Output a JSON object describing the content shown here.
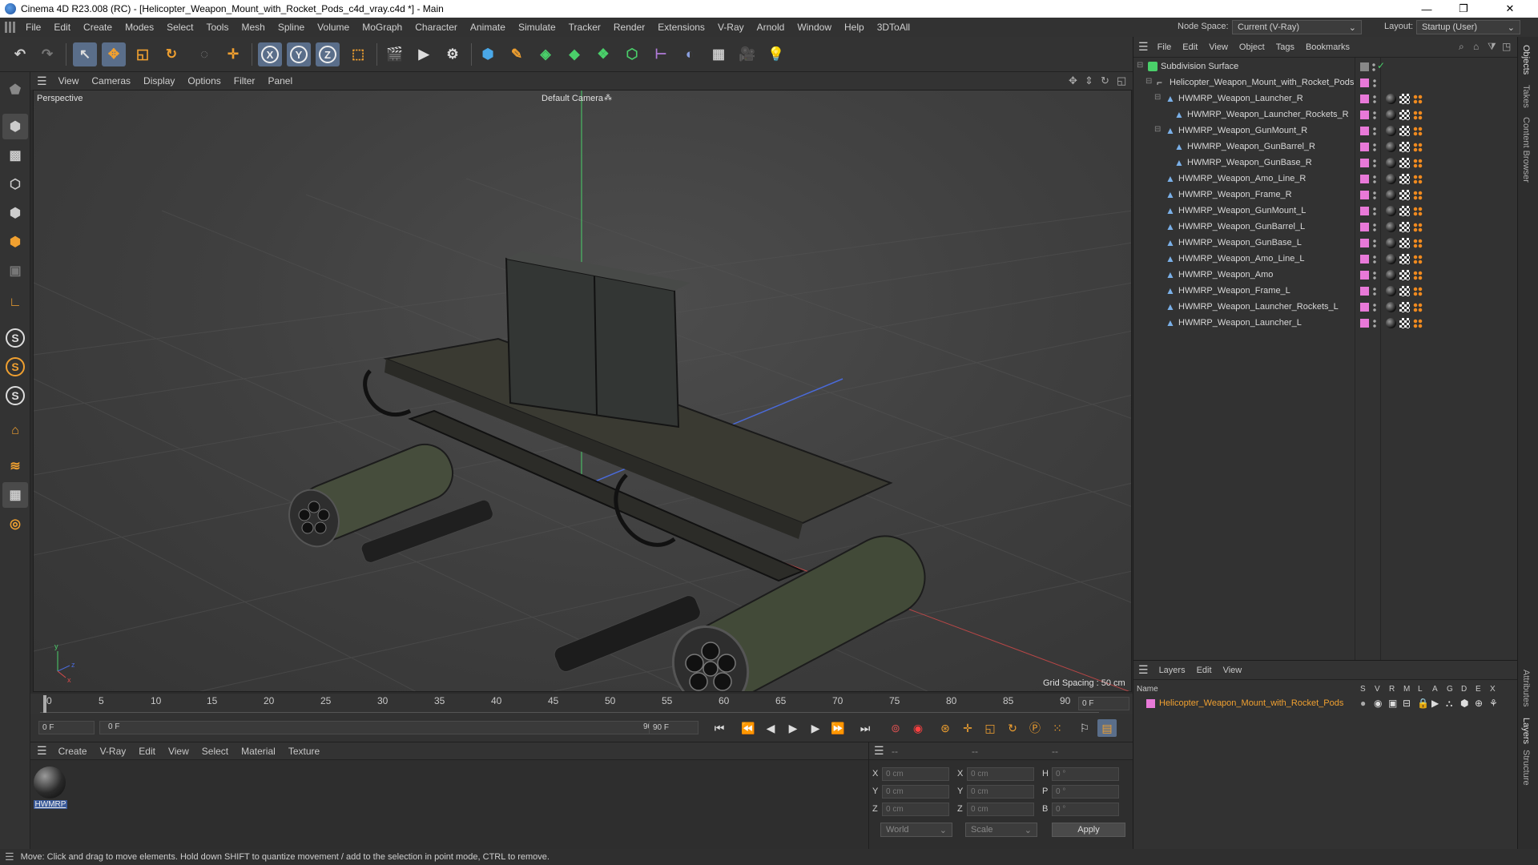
{
  "window": {
    "title": "Cinema 4D R23.008 (RC) - [Helicopter_Weapon_Mount_with_Rocket_Pods_c4d_vray.c4d *] - Main",
    "minimize": "—",
    "maximize": "❐",
    "close": "✕"
  },
  "menubar": {
    "items": [
      "File",
      "Edit",
      "Create",
      "Modes",
      "Select",
      "Tools",
      "Mesh",
      "Spline",
      "Volume",
      "MoGraph",
      "Character",
      "Animate",
      "Simulate",
      "Tracker",
      "Render",
      "Extensions",
      "V-Ray",
      "Arnold",
      "Window",
      "Help",
      "3DToAll"
    ],
    "node_space_label": "Node Space:",
    "node_space_value": "Current (V-Ray)",
    "layout_label": "Layout:",
    "layout_value": "Startup (User)"
  },
  "toolbar": {
    "x_label": "X",
    "y_label": "Y",
    "z_label": "Z"
  },
  "viewport": {
    "menu": [
      "View",
      "Cameras",
      "Display",
      "Options",
      "Filter",
      "Panel"
    ],
    "projection": "Perspective",
    "camera": "Default Camera",
    "grid_spacing": "Grid Spacing : 50 cm"
  },
  "timeline": {
    "ticks": [
      "0",
      "5",
      "10",
      "15",
      "20",
      "25",
      "30",
      "35",
      "40",
      "45",
      "50",
      "55",
      "60",
      "65",
      "70",
      "75",
      "80",
      "85",
      "90"
    ],
    "current_frame": "0 F",
    "start_field": "0 F",
    "range_start": "0 F",
    "range_end": "90 F",
    "end_field": "90 F"
  },
  "material_manager": {
    "menu": [
      "Create",
      "V-Ray",
      "Edit",
      "View",
      "Select",
      "Material",
      "Texture"
    ],
    "material_name": "HWMRP"
  },
  "coordinates": {
    "header_dashes": [
      "--",
      "--",
      "--"
    ],
    "rows": [
      {
        "a": "X",
        "av": "0 cm",
        "b": "X",
        "bv": "0 cm",
        "c": "H",
        "cv": "0 °"
      },
      {
        "a": "Y",
        "av": "0 cm",
        "b": "Y",
        "bv": "0 cm",
        "c": "P",
        "cv": "0 °"
      },
      {
        "a": "Z",
        "av": "0 cm",
        "b": "Z",
        "bv": "0 cm",
        "c": "B",
        "cv": "0 °"
      }
    ],
    "space": "World",
    "mode": "Scale",
    "apply": "Apply"
  },
  "object_manager": {
    "menu": [
      "File",
      "Edit",
      "View",
      "Object",
      "Tags",
      "Bookmarks"
    ],
    "objects": [
      {
        "name": "Subdivision Surface",
        "depth": 0,
        "type": "subdiv"
      },
      {
        "name": "Helicopter_Weapon_Mount_with_Rocket_Pods",
        "depth": 1,
        "type": "null"
      },
      {
        "name": "HWMRP_Weapon_Launcher_R",
        "depth": 2,
        "type": "mesh"
      },
      {
        "name": "HWMRP_Weapon_Launcher_Rockets_R",
        "depth": 3,
        "type": "mesh"
      },
      {
        "name": "HWMRP_Weapon_GunMount_R",
        "depth": 2,
        "type": "mesh"
      },
      {
        "name": "HWMRP_Weapon_GunBarrel_R",
        "depth": 3,
        "type": "mesh"
      },
      {
        "name": "HWMRP_Weapon_GunBase_R",
        "depth": 3,
        "type": "mesh"
      },
      {
        "name": "HWMRP_Weapon_Amo_Line_R",
        "depth": 2,
        "type": "mesh"
      },
      {
        "name": "HWMRP_Weapon_Frame_R",
        "depth": 2,
        "type": "mesh"
      },
      {
        "name": "HWMRP_Weapon_GunMount_L",
        "depth": 2,
        "type": "mesh"
      },
      {
        "name": "HWMRP_Weapon_GunBarrel_L",
        "depth": 2,
        "type": "mesh"
      },
      {
        "name": "HWMRP_Weapon_GunBase_L",
        "depth": 2,
        "type": "mesh"
      },
      {
        "name": "HWMRP_Weapon_Amo_Line_L",
        "depth": 2,
        "type": "mesh"
      },
      {
        "name": "HWMRP_Weapon_Amo",
        "depth": 2,
        "type": "mesh"
      },
      {
        "name": "HWMRP_Weapon_Frame_L",
        "depth": 2,
        "type": "mesh"
      },
      {
        "name": "HWMRP_Weapon_Launcher_Rockets_L",
        "depth": 2,
        "type": "mesh"
      },
      {
        "name": "HWMRP_Weapon_Launcher_L",
        "depth": 2,
        "type": "mesh"
      }
    ]
  },
  "layer_manager": {
    "menu": [
      "Layers",
      "Edit",
      "View"
    ],
    "name_header": "Name",
    "columns": [
      "S",
      "V",
      "R",
      "M",
      "L",
      "A",
      "G",
      "D",
      "E",
      "X"
    ],
    "layer_name": "Helicopter_Weapon_Mount_with_Rocket_Pods",
    "layer_color": "#e879d8"
  },
  "right_tabs": [
    "Objects",
    "Takes",
    "Content Browser",
    "Attributes",
    "Layers",
    "Structure"
  ],
  "status": "Move: Click and drag to move elements. Hold down SHIFT to quantize movement / add to the selection in point mode, CTRL to remove.",
  "colors": {
    "accent_blue": "#5a6e8a",
    "object_pink": "#e879d8",
    "layer_orange": "#f0a030"
  }
}
